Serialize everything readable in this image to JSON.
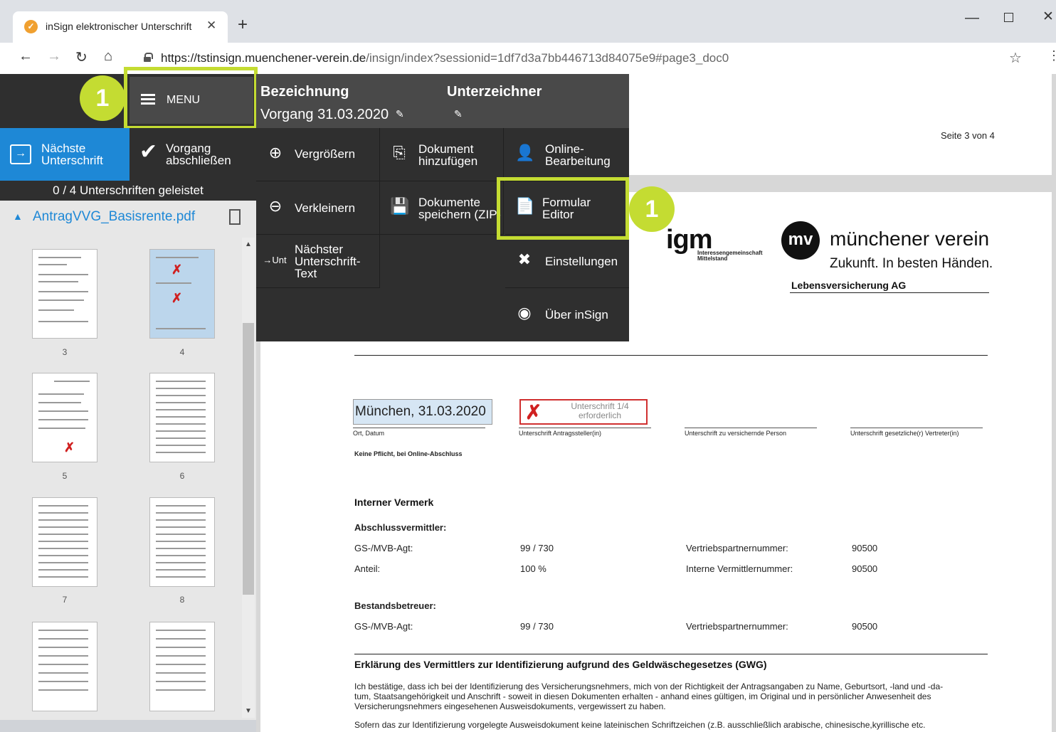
{
  "browser": {
    "tab_title": "inSign elektronischer Unterschrift",
    "url_host": "https://tstinsign.muenchener-verein.de",
    "url_path": "/insign/index?sessionid=1df7d3a7bb446713d84075e9#page3_doc0"
  },
  "app": {
    "menu_label": "MENU",
    "badge_number": "1",
    "next_signature_label_1": "Nächste",
    "next_signature_label_2": "Unterschrift",
    "finish_label_1": "Vorgang",
    "finish_label_2": "abschließen",
    "signature_count": "0 / 4 Unterschriften geleistet",
    "file_name": "AntragVVG_Basisrente.pdf"
  },
  "menu": {
    "col1_title": "Bezeichnung",
    "col1_value": "Vorgang 31.03.2020",
    "col2_title": "Unterzeichner",
    "items": [
      {
        "l1": "Vergrößern",
        "l2": ""
      },
      {
        "l1": "Dokument",
        "l2": "hinzufügen"
      },
      {
        "l1": "Online-",
        "l2": "Bearbeitung"
      },
      {
        "l1": "Verkleinern",
        "l2": ""
      },
      {
        "l1": "Dokumente",
        "l2": "speichern (ZIP)"
      },
      {
        "l1": "Formular",
        "l2": "Editor"
      },
      {
        "l1": "Nächster",
        "l2": "Unterschrift-",
        "l3": "Text",
        "icon_text": "→Unt"
      },
      {
        "l1": "Einstellungen",
        "l2": ""
      },
      {
        "l1": "Über inSign",
        "l2": ""
      }
    ]
  },
  "thumbnails": {
    "pages": [
      "3",
      "4",
      "5",
      "6",
      "7",
      "8"
    ]
  },
  "document": {
    "page_indicator": "Seite 3 von 4",
    "logo_igm": "igm",
    "logo_igm_sub_1": "Interessengemeinschaft",
    "logo_igm_sub_2": "Mittelstand",
    "logo_mv": "mv",
    "mv_name": "münchener verein",
    "mv_slogan": "Zukunft. In besten Händen.",
    "mv_ag": "Lebensversicherung AG",
    "place_date": "München, 31.03.2020",
    "sig_box_1": "Unterschrift 1/4",
    "sig_box_2": "erforderlich",
    "label_ort": "Ort, Datum",
    "label_antrag": "Unterschrift Antragssteller(in)",
    "label_versichert": "Unterschrift zu versichernde Person",
    "label_vertreter": "Unterschrift gesetzliche(r) Vertreter(in)",
    "keine_pflicht": "Keine Pflicht, bei Online-Abschluss",
    "interner_vermerk": "Interner Vermerk",
    "abschluss": "Abschlussvermittler:",
    "gs_label": "GS-/MVB-Agt:",
    "gs_value": "99 / 730",
    "vp_label": "Vertriebspartnernummer:",
    "vp_value": "90500",
    "anteil_label": "Anteil:",
    "anteil_value": "100 %",
    "iv_label": "Interne Vermittlernummer:",
    "iv_value": "90500",
    "bestand": "Bestandsbetreuer:",
    "gs2_value": "99 / 730",
    "vp2_value": "90500",
    "gwg_title": "Erklärung des Vermittlers zur Identifizierung aufgrund des Geldwäschegesetzes (GWG)",
    "gwg_p1_l1": "Ich bestätige, dass ich bei der Identifizierung des Versicherungsnehmers, mich von der Richtigkeit der Antragsangaben zu Name, Geburtsort, -land und -da-",
    "gwg_p1_l2": "tum, Staatsangehörigkeit und Anschrift - soweit in diesen Dokumenten erhalten - anhand eines gültigen, im Original und in persönlicher Anwesenheit des",
    "gwg_p1_l3": "Versicherungsnehmers eingesehenen Ausweisdokuments, vergewissert zu haben.",
    "gwg_p2_l1": "Sofern das zur Identifizierung vorgelegte Ausweisdokument keine lateinischen Schriftzeichen (z.B. ausschließlich arabische, chinesische,kyrillische etc."
  },
  "colors": {
    "accent_blue": "#1e88d6",
    "highlight_green": "#c4dc32",
    "menu_dark": "#2f2f2f",
    "signature_red": "#d02020"
  }
}
